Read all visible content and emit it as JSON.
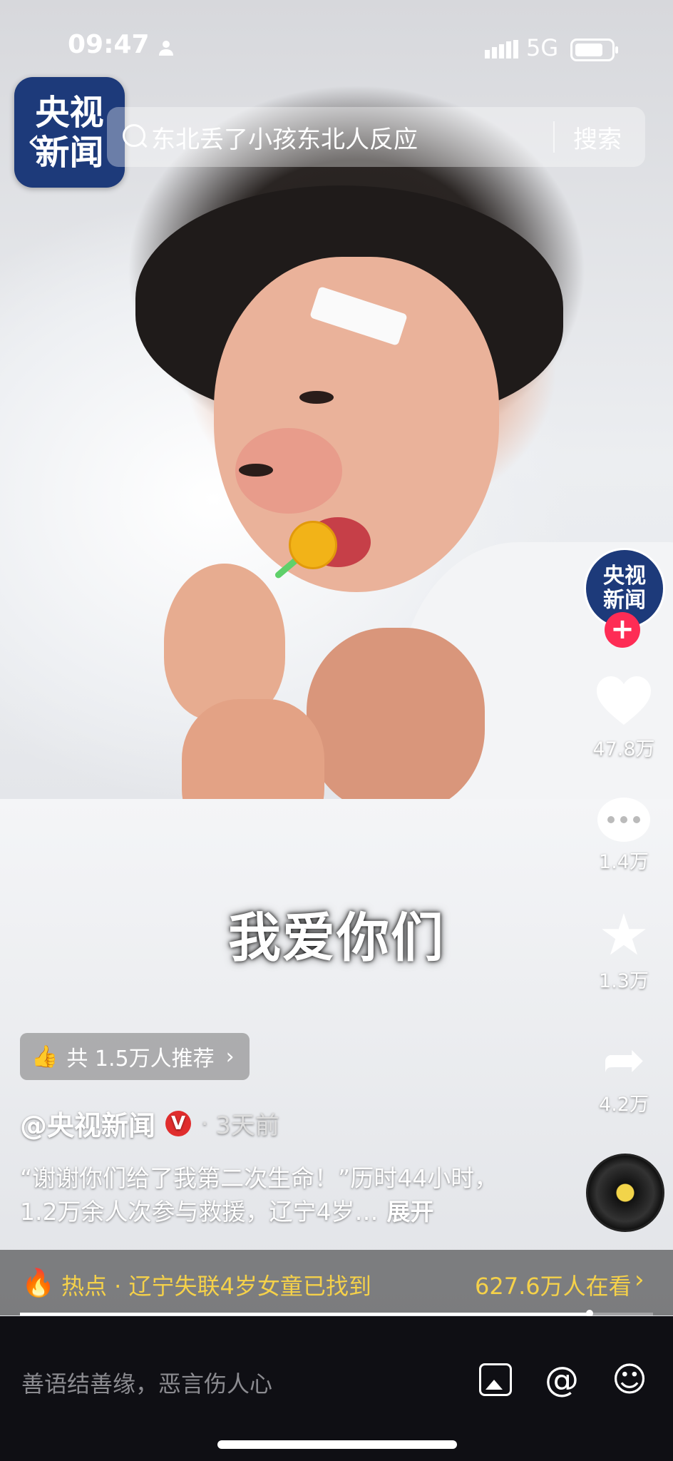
{
  "status_bar": {
    "time": "09:47",
    "network": "5G",
    "icons": [
      "person-icon",
      "signal-icon",
      "battery-icon"
    ]
  },
  "header": {
    "logo_line1": "央视",
    "logo_line2": "新闻",
    "search_query": "东北丢了小孩东北人反应",
    "search_button": "搜索"
  },
  "video": {
    "subtitle": "我爱你们"
  },
  "sidebar": {
    "avatar_line1": "央视",
    "avatar_line2": "新闻",
    "follow": "+",
    "likes": "47.8万",
    "comments": "1.4万",
    "favorites": "1.3万",
    "shares": "4.2万"
  },
  "recommend": {
    "label": "共 1.5万人推荐"
  },
  "post": {
    "author": "@央视新闻",
    "verified": "V",
    "separator": "·",
    "time_ago": "3天前",
    "description": "“谢谢你们给了我第二次生命！”历时44小时，1.2万余人次参与救援，辽宁4岁…",
    "expand": "展开"
  },
  "hot_topic": {
    "label": "热点 · 辽宁失联4岁女童已找到",
    "viewers": "627.6万人在看"
  },
  "playback": {
    "progress": 0.9
  },
  "comment_bar": {
    "placeholder": "善语结善缘，恶言伤人心"
  },
  "colors": {
    "accent": "#fe2c55",
    "hot_text": "#f5d14a",
    "logo_bg": "#1d3a7a"
  }
}
